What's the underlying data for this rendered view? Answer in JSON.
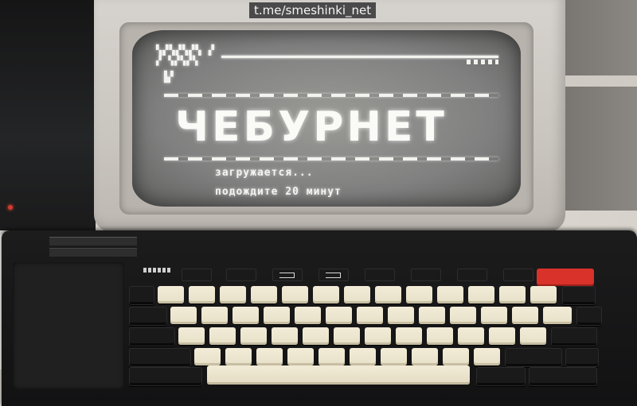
{
  "watermark": "t.me/smeshinki_net",
  "screen": {
    "title": "ЧЕБУРНЕТ",
    "loading_line1": "загружается...",
    "loading_line2": "подождите 20 минут"
  },
  "colors": {
    "screen_bg": "#808080",
    "screen_text": "#f3f3f0",
    "monitor_case": "#d6d3ce",
    "keycap": "#f2ecd8",
    "computer_body": "#1c1c1d",
    "accent_red_key": "#d8322a"
  }
}
